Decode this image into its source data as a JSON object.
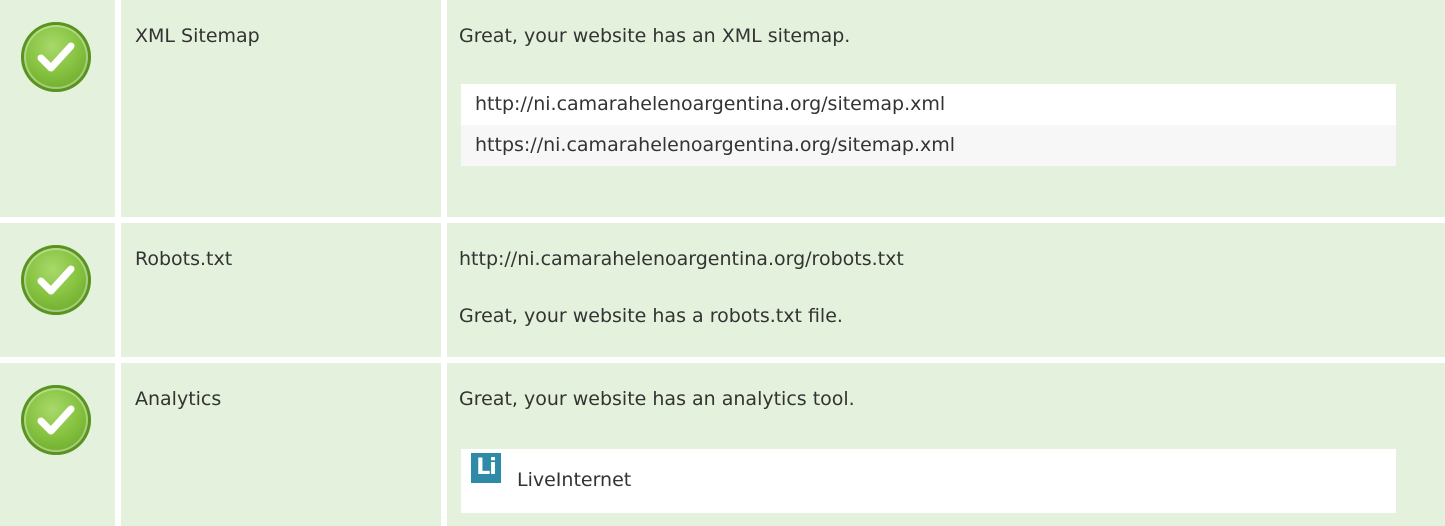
{
  "rows": [
    {
      "label": "XML Sitemap",
      "status_icon": "check-circle-icon",
      "message": "Great, your website has an XML sitemap.",
      "urls": [
        "http://ni.camarahelenoargentina.org/sitemap.xml",
        "https://ni.camarahelenoargentina.org/sitemap.xml"
      ]
    },
    {
      "label": "Robots.txt",
      "status_icon": "check-circle-icon",
      "url": "http://ni.camarahelenoargentina.org/robots.txt",
      "message": "Great, your website has a robots.txt file."
    },
    {
      "label": "Analytics",
      "status_icon": "check-circle-icon",
      "message": "Great, your website has an analytics tool.",
      "tools": [
        {
          "logo_text": "Li",
          "name": "LiveInternet",
          "logo_icon": "liveinternet-logo-icon"
        }
      ]
    }
  ],
  "colors": {
    "row_background": "#e4f1dc",
    "check_green": "#86c240",
    "logo_blue": "#2f8aa8"
  }
}
